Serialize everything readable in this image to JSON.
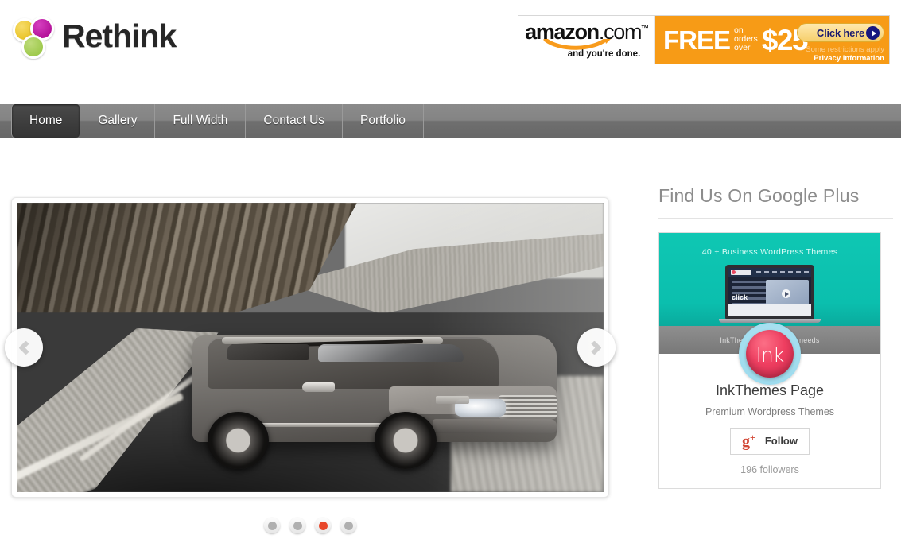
{
  "site": {
    "logo_text": "Rethink",
    "logo_colors": [
      "#e9c427",
      "#b5149b",
      "#9fca4e"
    ]
  },
  "ad": {
    "brand": "amazon",
    "domain": ".com",
    "tagline": "and you're done.",
    "free_label": "FREE",
    "small_line_1": "on",
    "small_line_2": "orders",
    "small_line_3": "over",
    "amount": "$25",
    "button_label": "Click here",
    "fine_print_1": "Some restrictions apply",
    "fine_print_2": "Privacy Information",
    "bg_color": "#f79b16"
  },
  "nav": {
    "items": [
      {
        "label": "Home",
        "active": true
      },
      {
        "label": "Gallery",
        "active": false
      },
      {
        "label": "Full Width",
        "active": false
      },
      {
        "label": "Contact Us",
        "active": false
      },
      {
        "label": "Portfolio",
        "active": false
      }
    ]
  },
  "slider": {
    "prev_icon": "chevron-left-icon",
    "next_icon": "chevron-right-icon",
    "slide_alt": "Silver Land Rover SUV driving on a mountain road",
    "dots": [
      {
        "active": false
      },
      {
        "active": false
      },
      {
        "active": true
      },
      {
        "active": false
      }
    ],
    "active_dot_color": "#e8472a"
  },
  "sidebar": {
    "widget_title": "Find Us On Google Plus",
    "google_plus": {
      "cover_text": "40 + Business WordPress Themes",
      "cover_color": "#0bbfae",
      "band_text": "InkThemes ... business needs",
      "avatar_text": "Ink",
      "page_name": "InkThemes Page",
      "page_description": "Premium Wordpress Themes",
      "follow_icon": "google-plus-icon",
      "follow_label": "Follow",
      "followers": "196 followers"
    }
  }
}
